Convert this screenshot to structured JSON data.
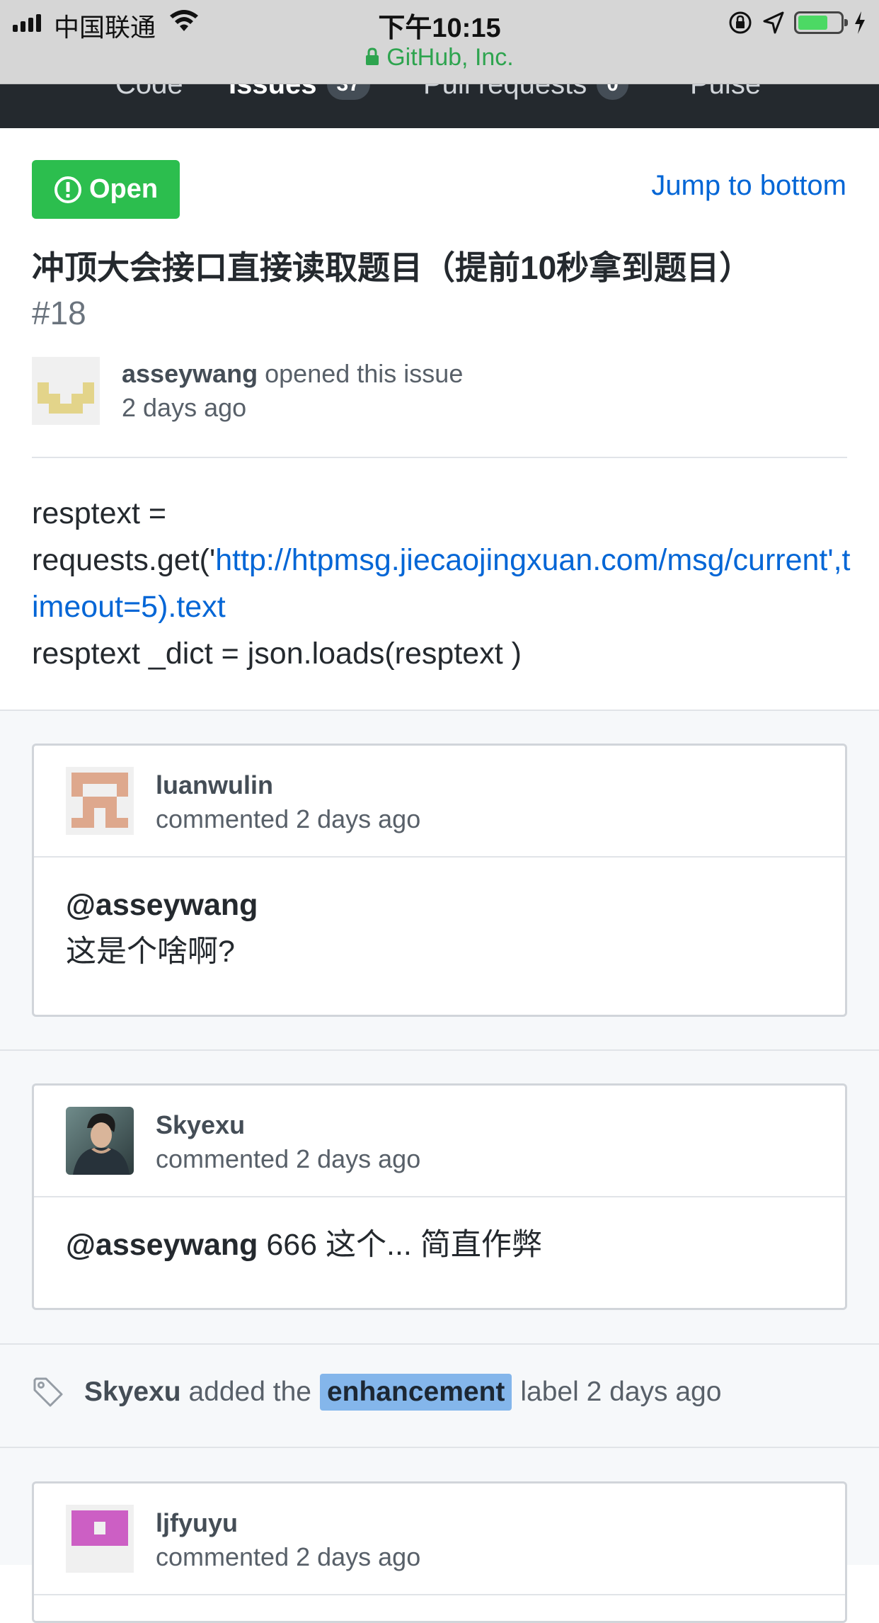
{
  "status_bar": {
    "carrier": "中国联通",
    "time": "下午10:15",
    "site": "GitHub, Inc.",
    "battery_level": 0.7
  },
  "repo_nav": {
    "tabs": [
      {
        "label": "Code"
      },
      {
        "label": "Issues",
        "count": "37"
      },
      {
        "label": "Pull requests",
        "count": "0"
      },
      {
        "label": "Pulse"
      }
    ]
  },
  "issue": {
    "state": "Open",
    "jump_label": "Jump to bottom",
    "title": "冲顶大会接口直接读取题目（提前10秒拿到题目）",
    "number": "#18",
    "author": "asseywang",
    "action": "opened this issue",
    "time": "2 days ago",
    "body": {
      "line1": "resptext =",
      "line2_prefix": "requests.get('",
      "link": "http://htpmsg.jiecaojingxuan.com/msg/current',timeout=5).text",
      "line3": "resptext _dict = json.loads(resptext )"
    }
  },
  "timeline": {
    "comments": [
      {
        "author": "luanwulin",
        "meta": "commented 2 days ago",
        "mention": "@asseywang",
        "text": "这是个啥啊?"
      },
      {
        "author": "Skyexu",
        "meta": "commented 2 days ago",
        "mention": "@asseywang",
        "text": " 666 这个... 简直作弊"
      },
      {
        "author": "ljfyuyu",
        "meta": "commented 2 days ago"
      }
    ],
    "label_event": {
      "actor": "Skyexu",
      "prefix": "added the",
      "label": "enhancement",
      "suffix": "label 2 days ago",
      "label_color": "#84b6eb"
    }
  }
}
